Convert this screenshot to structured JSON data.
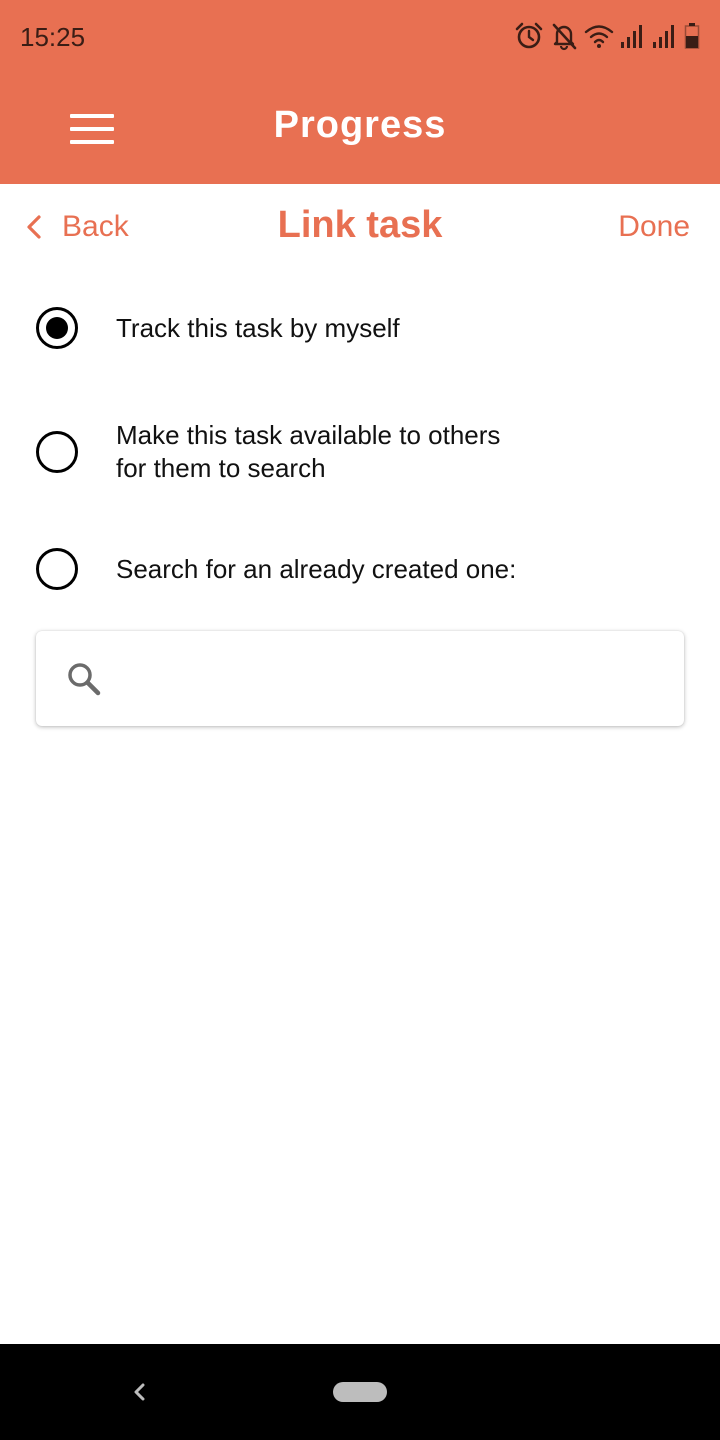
{
  "status_bar": {
    "time": "15:25",
    "icons": [
      "alarm-icon",
      "notifications-off-icon",
      "wifi-icon",
      "signal-icon",
      "signal-icon",
      "battery-low-icon"
    ]
  },
  "app_bar": {
    "title": "Progress",
    "menu_icon": "menu-icon"
  },
  "subnav": {
    "back_label": "Back",
    "title": "Link task",
    "done_label": "Done"
  },
  "options": [
    {
      "label": "Track this task by myself",
      "selected": true
    },
    {
      "label_line1": "Make this task available to others",
      "label_line2": "for them to search",
      "selected": false
    },
    {
      "label": "Search for an already created one:",
      "selected": false
    }
  ],
  "search": {
    "placeholder": "",
    "value": "",
    "icon": "search-icon"
  },
  "colors": {
    "accent": "#E87052",
    "text": "#111111",
    "nav_bar": "#000000"
  },
  "nav": {
    "icons": [
      "back-icon",
      "home-pill-icon"
    ]
  }
}
